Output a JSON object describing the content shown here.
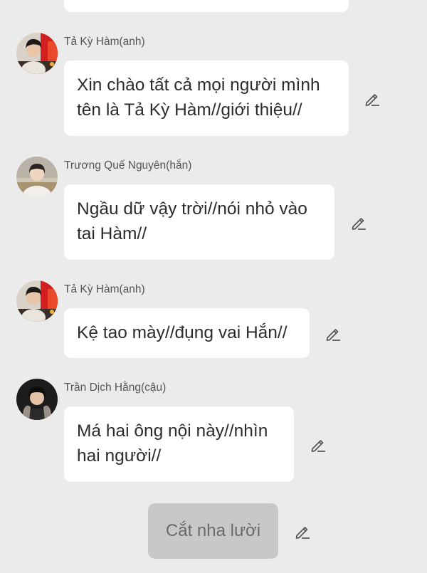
{
  "messages": [
    {
      "sender": "Tả Kỳ Hàm(anh)",
      "avatar": "avatar-ta-ky-ham",
      "text": "Xin chào tất cả mọi người mình\ntên là Tả Kỳ Hàm//giới thiệu//"
    },
    {
      "sender": "Trương Quế Nguyên(hắn)",
      "avatar": "avatar-truong-que-nguyen",
      "text": "Ngầu dữ vậy trời//nói nhỏ vào\ntai Hàm//"
    },
    {
      "sender": "Tả Kỳ Hàm(anh)",
      "avatar": "avatar-ta-ky-ham",
      "text": "Kệ tao mày//đụng vai Hắn//"
    },
    {
      "sender": "Trần Dịch Hằng(cậu)",
      "avatar": "avatar-tran-dich-hang",
      "text": "Má hai ông nội này//nhìn\nhai người//"
    }
  ],
  "self_message": {
    "text": "Cắt nha lười"
  },
  "icons": {
    "edit": "pencil-edit-icon"
  },
  "colors": {
    "background": "#ebebeb",
    "bubble": "#ffffff",
    "self_bubble": "#c8c8c8",
    "text": "#2b2b2b",
    "sender": "#555555"
  }
}
